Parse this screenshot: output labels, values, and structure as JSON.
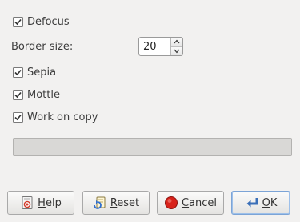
{
  "options": {
    "defocus": {
      "label": "Defocus",
      "checked": true
    },
    "border_size": {
      "label": "Border size:",
      "value": "20"
    },
    "sepia": {
      "label": "Sepia",
      "checked": true
    },
    "mottle": {
      "label": "Mottle",
      "checked": true
    },
    "work_on_copy": {
      "label": "Work on copy",
      "checked": true
    }
  },
  "progress": {
    "fraction": 0
  },
  "buttons": {
    "help": {
      "mnemonic": "H",
      "rest": "elp"
    },
    "reset": {
      "mnemonic": "R",
      "rest": "eset"
    },
    "cancel": {
      "mnemonic": "C",
      "rest": "ancel"
    },
    "ok": {
      "mnemonic": "O",
      "rest": "K"
    }
  },
  "icons": {
    "help": "help-icon",
    "reset": "reset-icon",
    "cancel": "cancel-icon",
    "ok": "ok-icon"
  },
  "colors": {
    "ok_border": "#7ca4d6",
    "cancel_red": "#d8231b"
  }
}
